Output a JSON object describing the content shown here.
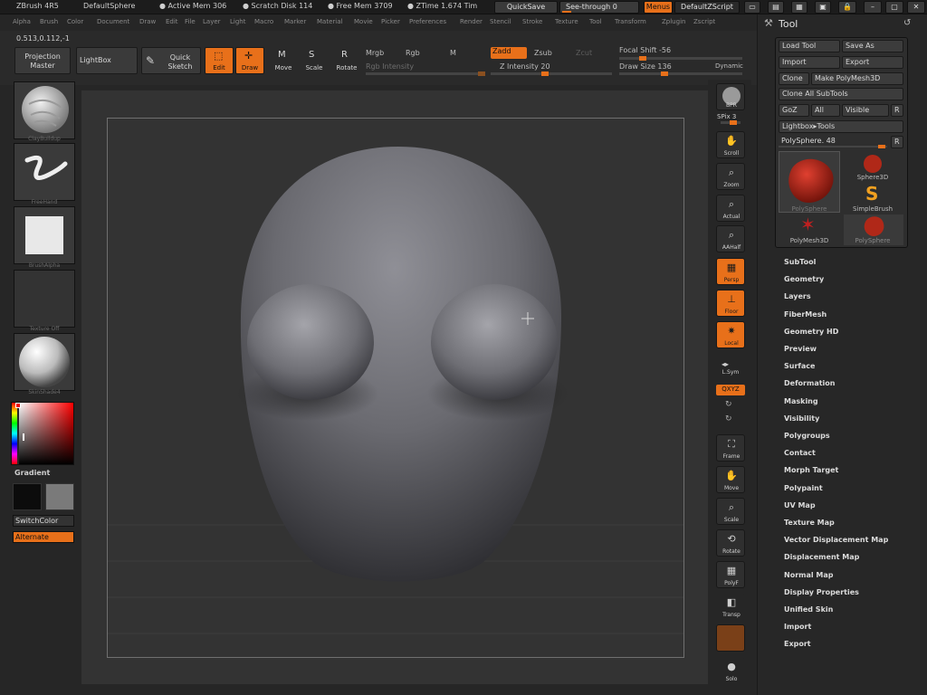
{
  "titlebar": {
    "app": "ZBrush 4R5",
    "document": "DefaultSphere",
    "active_mem": "● Active Mem 306",
    "scratch_disk": "● Scratch Disk 114",
    "free_mem": "● Free Mem 3709",
    "ztime": "● ZTime 1.674 Tim",
    "quicksave": "QuickSave",
    "see_through": "See-through  0",
    "menus": "Menus",
    "default_zscript": "DefaultZScript"
  },
  "menubar": [
    "Alpha",
    "Brush",
    "Color",
    "Document",
    "Draw",
    "Edit",
    "File",
    "Layer",
    "Light",
    "Macro",
    "Marker",
    "Material",
    "Movie",
    "Picker",
    "Preferences",
    "Render",
    "Stencil",
    "Stroke",
    "Texture",
    "Tool",
    "Transform",
    "Zplugin",
    "Zscript"
  ],
  "shelf": {
    "coords": "0.513,0.112,-1",
    "projection_master": "Projection Master",
    "lightbox": "LightBox",
    "quick_sketch": "Quick Sketch",
    "edit": "Edit",
    "draw": "Draw",
    "move": "Move",
    "scale": "Scale",
    "rotate": "Rotate",
    "mrgb": "Mrgb",
    "rgb": "Rgb",
    "m": "M",
    "rgb_intensity": "Rgb Intensity",
    "zadd": "Zadd",
    "zsub": "Zsub",
    "zcut": "Zcut",
    "z_intensity": "Z Intensity 20",
    "focal_shift": "Focal Shift -56",
    "draw_size": "Draw Size 136",
    "dynamic": "Dynamic"
  },
  "left": {
    "brush": "ClayBuildup",
    "stroke": "FreeHand",
    "alpha": "BrushAlpha",
    "texture": "Texture Off",
    "material": "SkinShade4",
    "gradient": "Gradient",
    "switchcolor": "SwitchColor",
    "alternate": "Alternate"
  },
  "right": {
    "bpr": "BPR",
    "spix": "SPix 3",
    "scroll": "Scroll",
    "zoom": "Zoom",
    "actual": "Actual",
    "aahalf": "AAHalf",
    "persp": "Persp",
    "floor": "Floor",
    "local": "Local",
    "lsym": "L.Sym",
    "xyz": "QXYZ",
    "frame": "Frame",
    "move": "Move",
    "scale": "Scale",
    "rotate": "Rotate",
    "polyf": "PolyF",
    "transp": "Transp",
    "solo": "Solo"
  },
  "tool": {
    "title": "Tool",
    "load_tool": "Load Tool",
    "save_as": "Save As",
    "import": "Import",
    "export": "Export",
    "clone": "Clone",
    "make_polymesh": "Make PolyMesh3D",
    "clone_all": "Clone All SubTools",
    "goz": "GoZ",
    "all": "All",
    "visible": "Visible",
    "r": "R",
    "lightbox_tools": "Lightbox▸Tools",
    "polysphere": "PolySphere. 48",
    "thumbs": [
      "PolySphere",
      "Sphere3D",
      "SimpleBrush",
      "PolyMesh3D",
      "PolySphere"
    ]
  },
  "menu_items": [
    "SubTool",
    "Geometry",
    "Layers",
    "FiberMesh",
    "Geometry HD",
    "Preview",
    "Surface",
    "Deformation",
    "Masking",
    "Visibility",
    "Polygroups",
    "Contact",
    "Morph Target",
    "Polypaint",
    "UV Map",
    "Texture Map",
    "Vector Displacement Map",
    "Displacement Map",
    "Normal Map",
    "Display Properties",
    "Unified Skin",
    "Import",
    "Export"
  ],
  "colors": {
    "accent": "#e8701a",
    "bg": "#262626",
    "canvas": "#333333"
  }
}
